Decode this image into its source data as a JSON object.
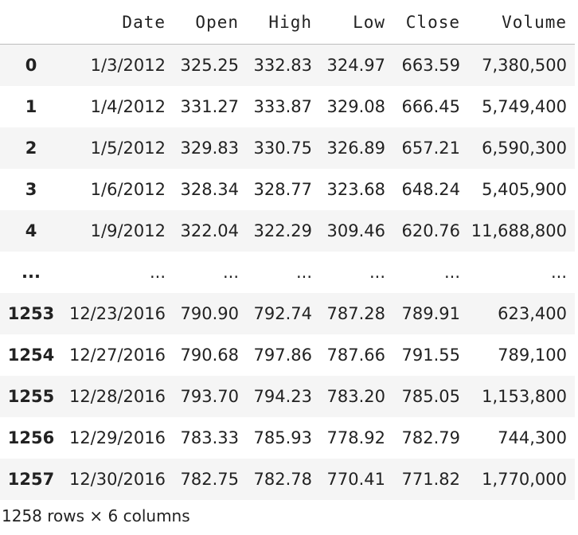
{
  "table": {
    "columns": [
      "",
      "Date",
      "Open",
      "High",
      "Low",
      "Close",
      "Volume"
    ],
    "rows": [
      {
        "index": "0",
        "cells": [
          "1/3/2012",
          "325.25",
          "332.83",
          "324.97",
          "663.59",
          "7,380,500"
        ]
      },
      {
        "index": "1",
        "cells": [
          "1/4/2012",
          "331.27",
          "333.87",
          "329.08",
          "666.45",
          "5,749,400"
        ]
      },
      {
        "index": "2",
        "cells": [
          "1/5/2012",
          "329.83",
          "330.75",
          "326.89",
          "657.21",
          "6,590,300"
        ]
      },
      {
        "index": "3",
        "cells": [
          "1/6/2012",
          "328.34",
          "328.77",
          "323.68",
          "648.24",
          "5,405,900"
        ]
      },
      {
        "index": "4",
        "cells": [
          "1/9/2012",
          "322.04",
          "322.29",
          "309.46",
          "620.76",
          "11,688,800"
        ]
      },
      {
        "index": "...",
        "cells": [
          "...",
          "...",
          "...",
          "...",
          "...",
          "..."
        ]
      },
      {
        "index": "1253",
        "cells": [
          "12/23/2016",
          "790.90",
          "792.74",
          "787.28",
          "789.91",
          "623,400"
        ]
      },
      {
        "index": "1254",
        "cells": [
          "12/27/2016",
          "790.68",
          "797.86",
          "787.66",
          "791.55",
          "789,100"
        ]
      },
      {
        "index": "1255",
        "cells": [
          "12/28/2016",
          "793.70",
          "794.23",
          "783.20",
          "785.05",
          "1,153,800"
        ]
      },
      {
        "index": "1256",
        "cells": [
          "12/29/2016",
          "783.33",
          "785.93",
          "778.92",
          "782.79",
          "744,300"
        ]
      },
      {
        "index": "1257",
        "cells": [
          "12/30/2016",
          "782.75",
          "782.78",
          "770.41",
          "771.82",
          "1,770,000"
        ]
      }
    ]
  },
  "footer": "1258 rows × 6 columns"
}
